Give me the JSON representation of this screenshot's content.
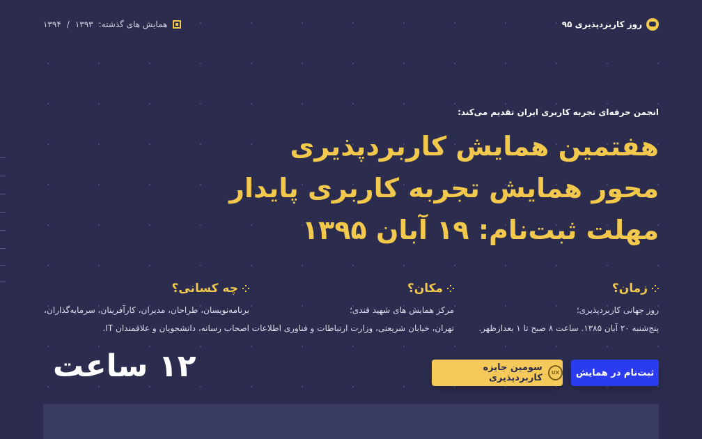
{
  "header": {
    "brand": "روز کاربردپذیری ۹۵",
    "previous_label": "همایش های گذشته:",
    "previous_years": [
      "۱۳۹۳",
      "۱۳۹۴"
    ],
    "separator": "/"
  },
  "hero": {
    "presenter": "انجمن حرفه‌ای تجربه کاربری ایران تقدیم می‌کند:",
    "line1": "هفتمین همایش کاربردپذیری",
    "line2": "محور همایش تجربه کاربری پایدار",
    "line3": "مهلت ثبت‌نام: ۱۹ آبان ۱۳۹۵"
  },
  "info": {
    "when": {
      "title": "زمان؟",
      "line1": "روز جهانی کاربردپذیری؛",
      "line2": "پنج‌شنبه ۲۰ آبان ۱۳۸۵. ساعت ۸ صبح تا ۱ بعدازظهر."
    },
    "where": {
      "title": "مکان؟",
      "line1": "مرکز همایش های شهید قندی؛",
      "line2": "تهران، خیابان شریعتی، وزارت ارتباطات و فناوری اطلاعات"
    },
    "who": {
      "title": "چه کسانی؟",
      "line1": "برنامه‌نویسان، طراحان، مدیران، کارآفرینان، سرمایه‌گذاران،",
      "line2": "اصحاب رسانه، دانشجویان و علاقمندان IT."
    }
  },
  "actions": {
    "register": "ثبت‌نام در همایش",
    "award": "سومین جایزه کاربردپذیری",
    "award_badge": "UX"
  },
  "hours": "۱۲ ساعت",
  "colors": {
    "background": "#2c2d4e",
    "accent": "#f2c94c",
    "primary": "#2b3cf0"
  }
}
